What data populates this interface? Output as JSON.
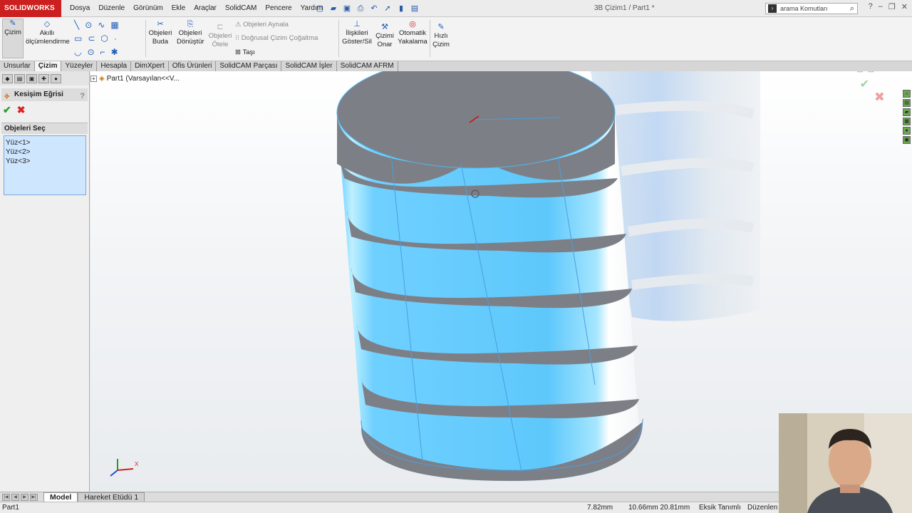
{
  "app": {
    "logo": "SOLIDWORKS",
    "doc_title": "3B Çizim1 / Part1 *"
  },
  "menu": [
    "Dosya",
    "Düzenle",
    "Görünüm",
    "Ekle",
    "Araçlar",
    "SolidCAM",
    "Pencere",
    "Yardım"
  ],
  "search": {
    "placeholder": "arama Komutları"
  },
  "ribbon": {
    "cizim": "Çizim",
    "akilli": "Akıllı ölçümlendirme",
    "objeleri_buda": "Objeleri Buda",
    "objeleri_donustur": "Objeleri Dönüştür",
    "objeleri_otele": "Objeleri Ötele",
    "objeleri_aynala": "Objeleri Aynala",
    "dogrusal": "Doğrusal Çizim Çoğaltma",
    "tasi": "Taşı",
    "iliskileri": "İlişkileri Göster/Sil",
    "cizimi_onar": "Çizimi Onar",
    "otomatik": "Otomatik Yakalama",
    "hizli": "Hızlı Çizim"
  },
  "tabs": [
    "Unsurlar",
    "Çizim",
    "Yüzeyler",
    "Hesapla",
    "DimXpert",
    "Ofis Ürünleri",
    "SolidCAM Parçası",
    "SolidCAM İşler",
    "SolidCAM AFRM"
  ],
  "panel": {
    "feature_title": "Kesişim Eğrisi",
    "select_header": "Objeleri Seç",
    "selections": [
      "Yüz<1>",
      "Yüz<2>",
      "Yüz<3>"
    ]
  },
  "tree": {
    "label": "Part1  (Varsayılan<<V..."
  },
  "bottom_tabs": [
    "Model",
    "Hareket Etüdü 1"
  ],
  "status": {
    "part": "Part1",
    "length": "7.82mm",
    "coords": "10.66mm 20.81mm",
    "state": "Eksik Tanımlı",
    "mode": "Düzenlen"
  },
  "colors": {
    "brand": "#cc1f1f",
    "face_blue": "#6fd0ff",
    "face_gray": "#7d7f86"
  }
}
